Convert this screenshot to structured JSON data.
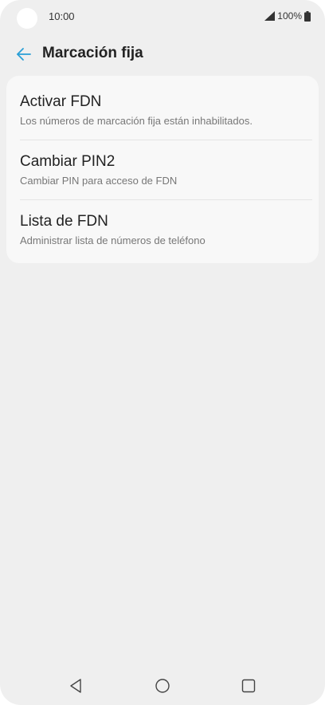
{
  "status_bar": {
    "time": "10:00",
    "battery": "100%",
    "icons": [
      "signal-icon",
      "battery-icon"
    ]
  },
  "app_bar": {
    "title": "Marcación fija",
    "back_icon": "arrow-left-icon"
  },
  "colors": {
    "accent": "#2a9fd6",
    "background": "#efefef",
    "card": "#f8f8f8"
  },
  "list": {
    "items": [
      {
        "title": "Activar FDN",
        "subtitle": "Los números de marcación fija están inhabilitados."
      },
      {
        "title": "Cambiar PIN2",
        "subtitle": "Cambiar PIN para acceso de FDN"
      },
      {
        "title": "Lista de FDN",
        "subtitle": "Administrar lista de números de teléfono"
      }
    ]
  },
  "nav_bar": {
    "icons": [
      "back-triangle-icon",
      "home-circle-icon",
      "recents-square-icon"
    ]
  }
}
